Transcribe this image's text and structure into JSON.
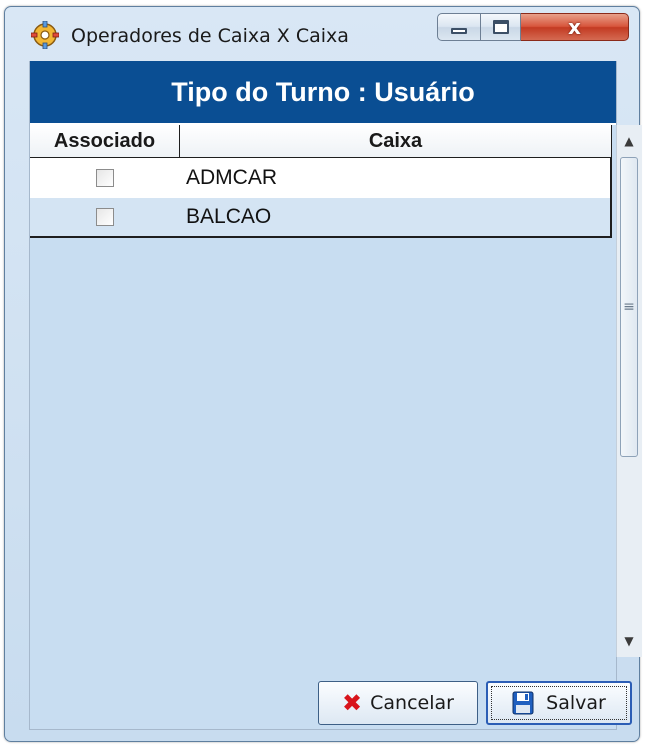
{
  "window": {
    "title": "Operadores de Caixa X Caixa",
    "icons": {
      "app": "settings-gear-app-icon",
      "minimize": "minimize-icon",
      "maximize": "maximize-icon",
      "close": "close-x-icon"
    },
    "close_glyph": "x"
  },
  "header": {
    "title": "Tipo do Turno : Usuário"
  },
  "grid": {
    "columns": [
      "Associado",
      "Caixa"
    ],
    "rows": [
      {
        "associado": false,
        "caixa": "ADMCAR"
      },
      {
        "associado": false,
        "caixa": "BALCAO"
      }
    ]
  },
  "scrollbar": {
    "up_icon": "scroll-up-icon",
    "down_icon": "scroll-down-icon"
  },
  "buttons": {
    "cancel_label": "Cancelar",
    "cancel_icon": "red-x-icon",
    "save_label": "Salvar",
    "save_icon": "floppy-disk-icon"
  },
  "colors": {
    "header_bg": "#0a4e93",
    "client_bg": "#c8ddf1",
    "row_alt_bg": "#d4e4f3",
    "close_btn": "#c33a22",
    "cancel_icon": "#d8141c"
  }
}
